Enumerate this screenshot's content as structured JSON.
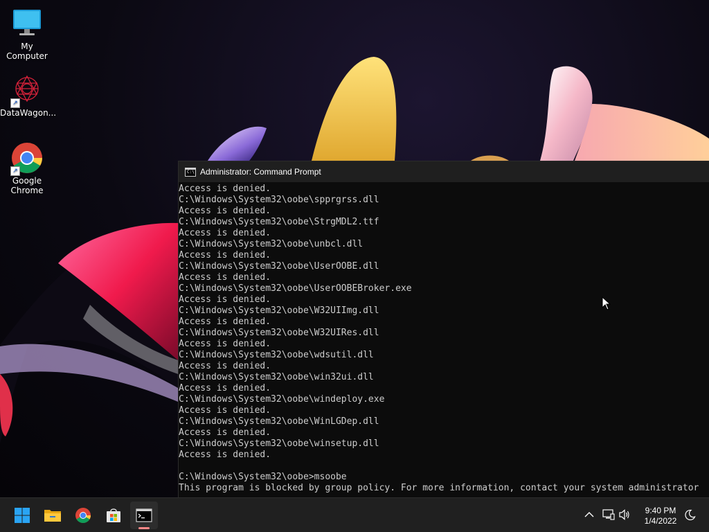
{
  "desktop": {
    "icons": [
      {
        "label": "My Computer",
        "icon": "computer-icon"
      },
      {
        "label": "DataWagon...",
        "icon": "datawagon-icon",
        "shortcut": true
      },
      {
        "label": "Google\nChrome",
        "icon": "chrome-icon",
        "shortcut": true
      }
    ]
  },
  "cmd": {
    "title": "Administrator: Command Prompt",
    "lines": [
      "Access is denied.",
      "C:\\Windows\\System32\\oobe\\spprgrss.dll",
      "Access is denied.",
      "C:\\Windows\\System32\\oobe\\StrgMDL2.ttf",
      "Access is denied.",
      "C:\\Windows\\System32\\oobe\\unbcl.dll",
      "Access is denied.",
      "C:\\Windows\\System32\\oobe\\UserOOBE.dll",
      "Access is denied.",
      "C:\\Windows\\System32\\oobe\\UserOOBEBroker.exe",
      "Access is denied.",
      "C:\\Windows\\System32\\oobe\\W32UIImg.dll",
      "Access is denied.",
      "C:\\Windows\\System32\\oobe\\W32UIRes.dll",
      "Access is denied.",
      "C:\\Windows\\System32\\oobe\\wdsutil.dll",
      "Access is denied.",
      "C:\\Windows\\System32\\oobe\\win32ui.dll",
      "Access is denied.",
      "C:\\Windows\\System32\\oobe\\windeploy.exe",
      "Access is denied.",
      "C:\\Windows\\System32\\oobe\\WinLGDep.dll",
      "Access is denied.",
      "C:\\Windows\\System32\\oobe\\winsetup.dll",
      "Access is denied.",
      "",
      "C:\\Windows\\System32\\oobe>msoobe",
      "This program is blocked by group policy. For more information, contact your system administrator"
    ]
  },
  "taskbar": {
    "apps": [
      {
        "name": "start-button",
        "icon": "windows-logo-icon"
      },
      {
        "name": "file-explorer-button",
        "icon": "folder-icon"
      },
      {
        "name": "chrome-button",
        "icon": "chrome-icon"
      },
      {
        "name": "store-button",
        "icon": "store-icon"
      },
      {
        "name": "command-prompt-button",
        "icon": "terminal-icon",
        "active": true
      }
    ],
    "tray": {
      "icons": [
        "chevron-up-icon",
        "network-icon",
        "volume-icon",
        "focus-assist-icon"
      ]
    },
    "clock": {
      "time": "9:40 PM",
      "date": "1/4/2022"
    }
  },
  "colors": {
    "taskbar": "#202020",
    "cmd_bg": "#0c0c0c",
    "cmd_text": "#cccccc"
  }
}
